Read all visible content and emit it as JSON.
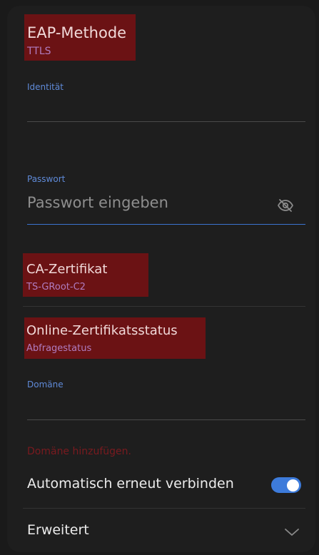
{
  "eap": {
    "title": "EAP-Methode",
    "value": "TTLS"
  },
  "identity": {
    "label": "Identität",
    "value": ""
  },
  "password": {
    "label": "Passwort",
    "placeholder": "Passwort eingeben",
    "visibility_icon": "eye-off-icon"
  },
  "ca_certificate": {
    "title": "CA-Zertifikat",
    "value": "TS-GRoot-C2"
  },
  "online_cert_status": {
    "title": "Online-Zertifikatsstatus",
    "value": "Abfragestatus"
  },
  "domain": {
    "label": "Domäne",
    "value": "",
    "add_link": "Domäne hinzufügen."
  },
  "auto_reconnect": {
    "label": "Automatisch erneut verbinden",
    "enabled": true
  },
  "advanced": {
    "label": "Erweitert",
    "icon": "chevron-down-icon"
  },
  "colors": {
    "background": "#1e1e1e",
    "highlight": "#6b1214",
    "accent_blue": "#3d7bdb",
    "label_blue": "#5f8ad8",
    "sub_purple": "#b07cc0"
  }
}
